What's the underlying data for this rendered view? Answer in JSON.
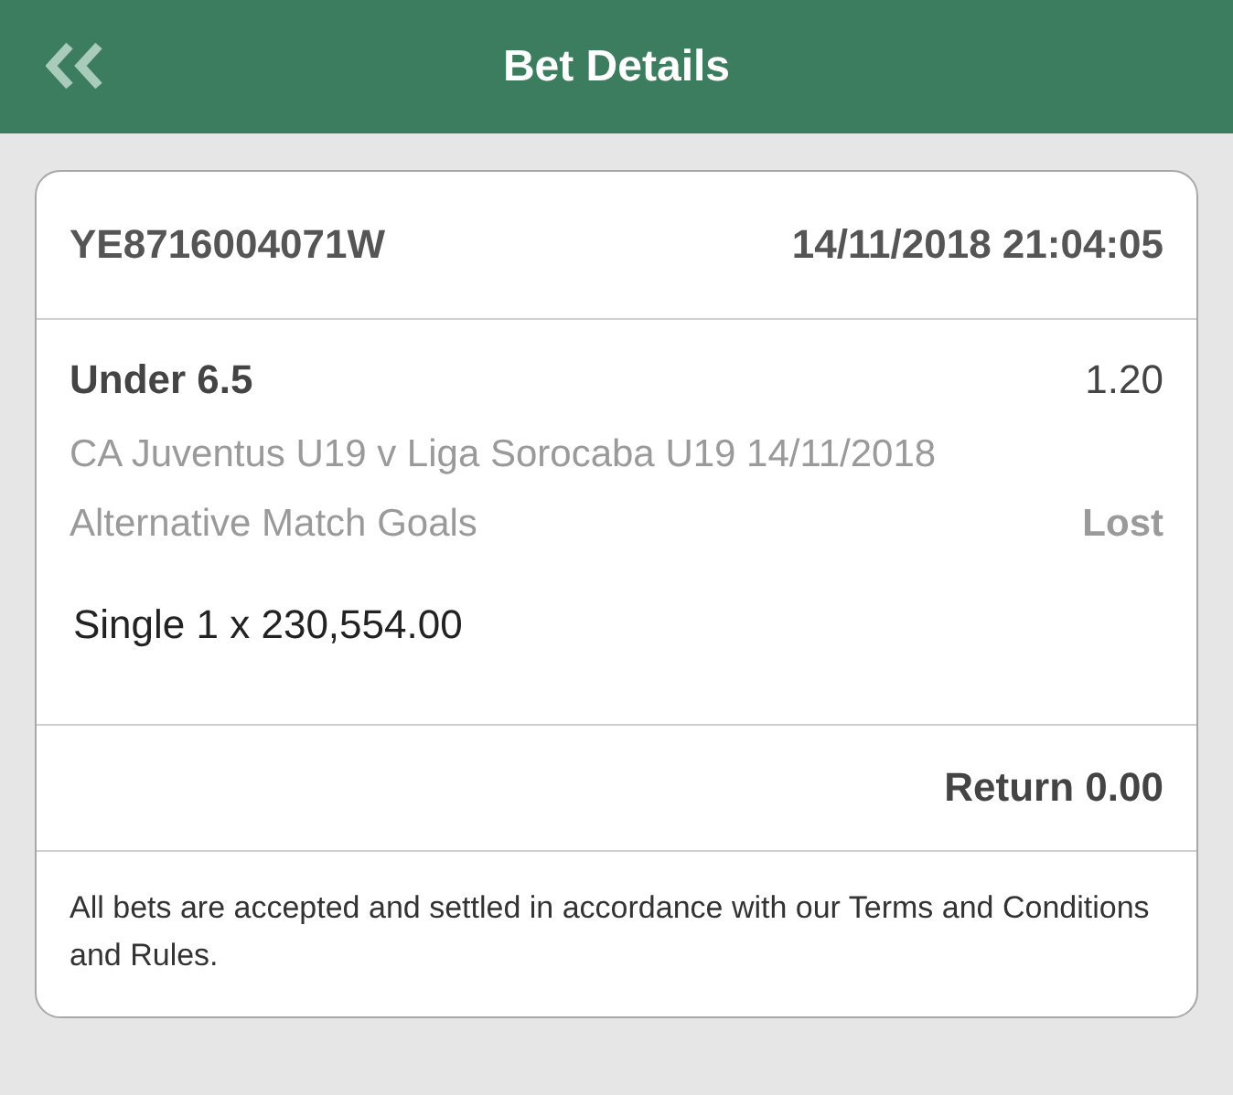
{
  "header": {
    "title": "Bet Details"
  },
  "bet": {
    "reference": "YE8716004071W",
    "placed_at": "14/11/2018 21:04:05"
  },
  "selection": {
    "name": "Under 6.5",
    "odds": "1.20",
    "event": "CA Juventus U19 v Liga Sorocaba U19 14/11/2018",
    "market": "Alternative Match Goals",
    "result": "Lost"
  },
  "stake": "Single 1 x 230,554.00",
  "return": "Return 0.00",
  "terms": "All bets are accepted and settled in accordance with our Terms and Conditions and Rules."
}
